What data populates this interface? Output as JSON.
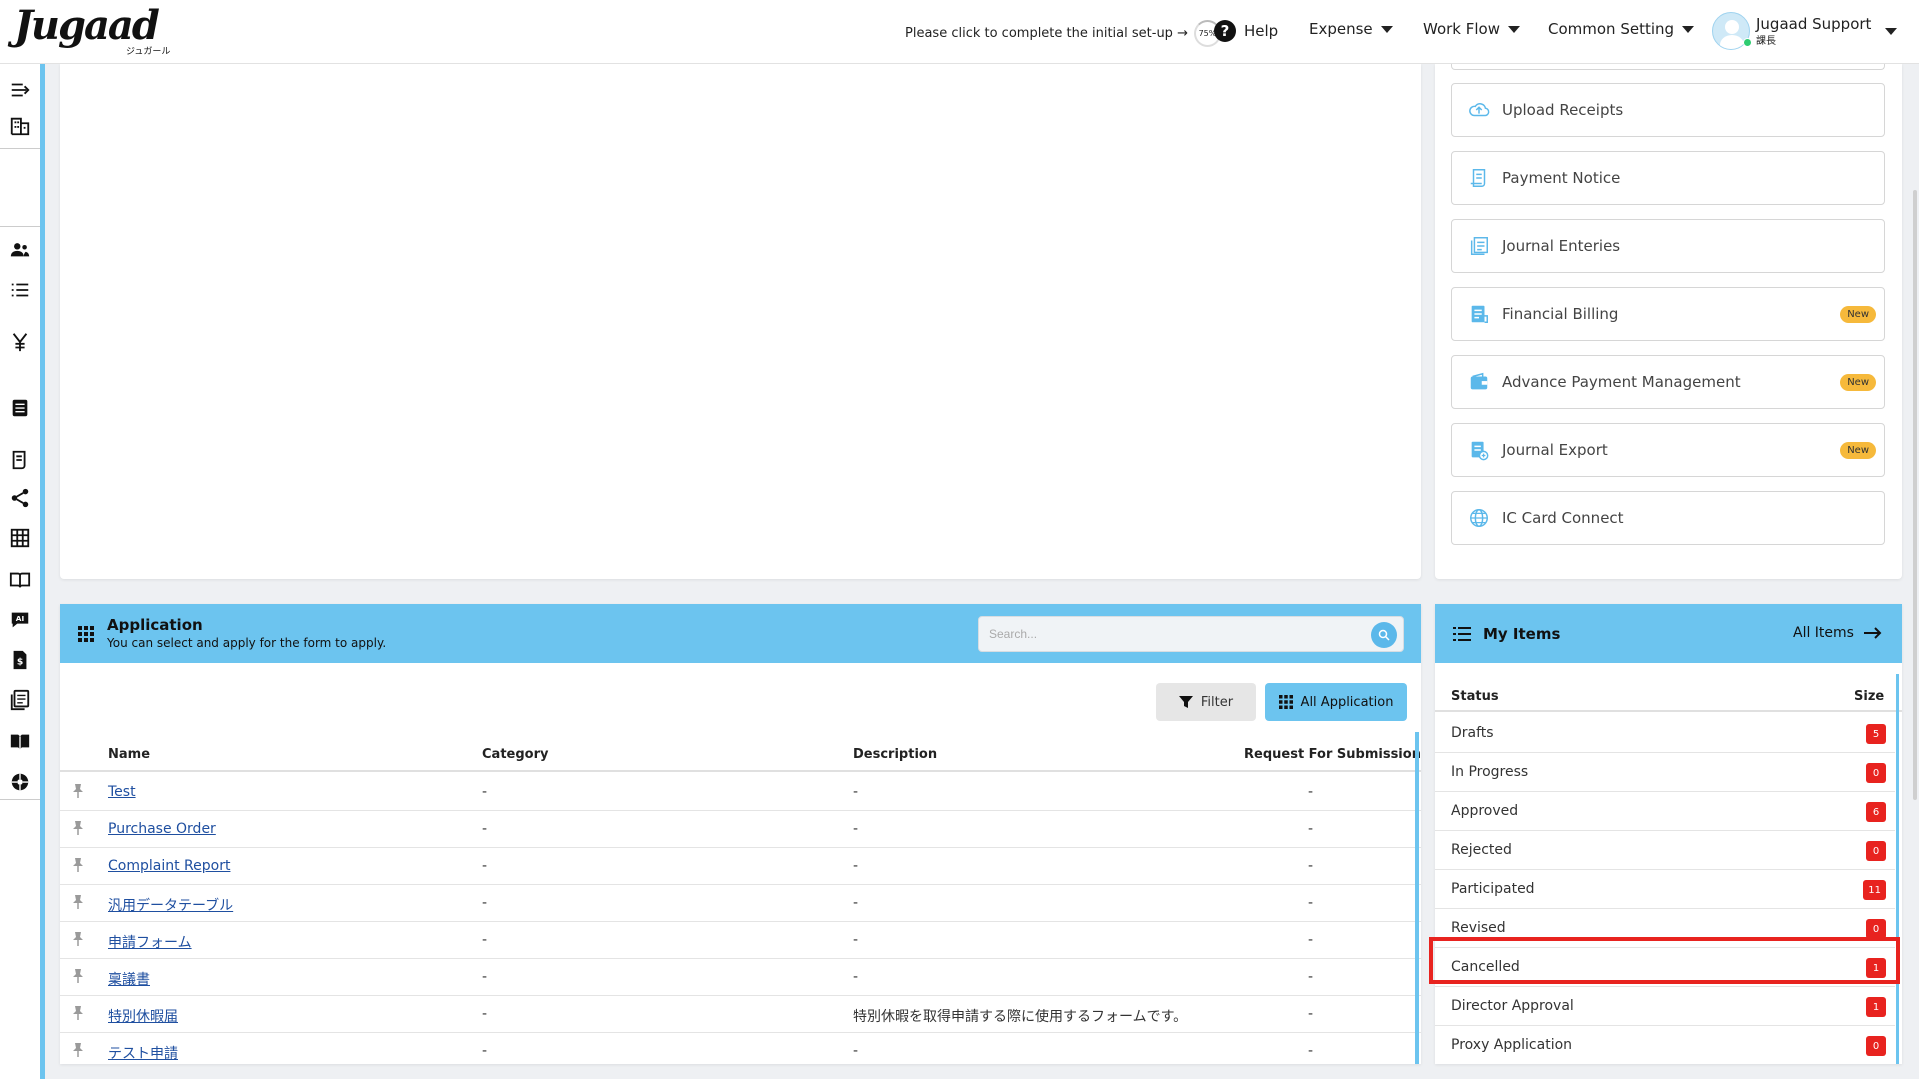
{
  "header": {
    "logo": "Jugaad",
    "logo_sub": "ジュガール",
    "setup_text": "Please click to complete the initial set-up →",
    "setup_progress": "75%",
    "help": "Help",
    "nav": [
      "Expense",
      "Work Flow",
      "Common Setting"
    ],
    "user_name": "Jugaad Support",
    "user_role": "課長"
  },
  "tools": [
    {
      "label": "Upload Receipts",
      "icon": "cloud-upload-icon",
      "badge": ""
    },
    {
      "label": "Payment Notice",
      "icon": "receipt-icon",
      "badge": ""
    },
    {
      "label": "Journal Enteries",
      "icon": "journal-icon",
      "badge": ""
    },
    {
      "label": "Financial Billing",
      "icon": "billing-icon",
      "badge": "New"
    },
    {
      "label": "Advance Payment Management",
      "icon": "wallet-icon",
      "badge": "New"
    },
    {
      "label": "Journal Export",
      "icon": "export-icon",
      "badge": "New"
    },
    {
      "label": "IC Card Connect",
      "icon": "globe-icon",
      "badge": ""
    }
  ],
  "application": {
    "title": "Application",
    "subtitle": "You can select and apply for the form to apply.",
    "search_placeholder": "Search...",
    "filter_label": "Filter",
    "all_label": "All Application",
    "columns": [
      "Name",
      "Category",
      "Description",
      "Request For Submission"
    ],
    "rows": [
      {
        "name": "Test",
        "category": "-",
        "description": "-",
        "request": "-"
      },
      {
        "name": "Purchase Order",
        "category": "-",
        "description": "-",
        "request": "-"
      },
      {
        "name": "Complaint Report",
        "category": "-",
        "description": "-",
        "request": "-"
      },
      {
        "name": "汎用データテーブル",
        "category": "-",
        "description": "-",
        "request": "-"
      },
      {
        "name": "申請フォーム",
        "category": "-",
        "description": "-",
        "request": "-"
      },
      {
        "name": "稟議書",
        "category": "-",
        "description": "-",
        "request": "-"
      },
      {
        "name": "特別休暇届",
        "category": "-",
        "description": "特別休暇を取得申請する際に使用するフォームです。",
        "request": "-"
      },
      {
        "name": "テスト申請",
        "category": "-",
        "description": "-",
        "request": "-"
      }
    ]
  },
  "my_items": {
    "title": "My Items",
    "all_items": "All Items",
    "col_status": "Status",
    "col_size": "Size",
    "rows": [
      {
        "label": "Drafts",
        "count": "5"
      },
      {
        "label": "In Progress",
        "count": "0"
      },
      {
        "label": "Approved",
        "count": "6"
      },
      {
        "label": "Rejected",
        "count": "0"
      },
      {
        "label": "Participated",
        "count": "11"
      },
      {
        "label": "Revised",
        "count": "0"
      },
      {
        "label": "Cancelled",
        "count": "1"
      },
      {
        "label": "Director Approval",
        "count": "1"
      },
      {
        "label": "Proxy Application",
        "count": "0"
      }
    ]
  },
  "colors": {
    "accent": "#6cc4ef",
    "badge_red": "#e8231f",
    "badge_new": "#f6b93b",
    "link": "#1f4fa0"
  }
}
